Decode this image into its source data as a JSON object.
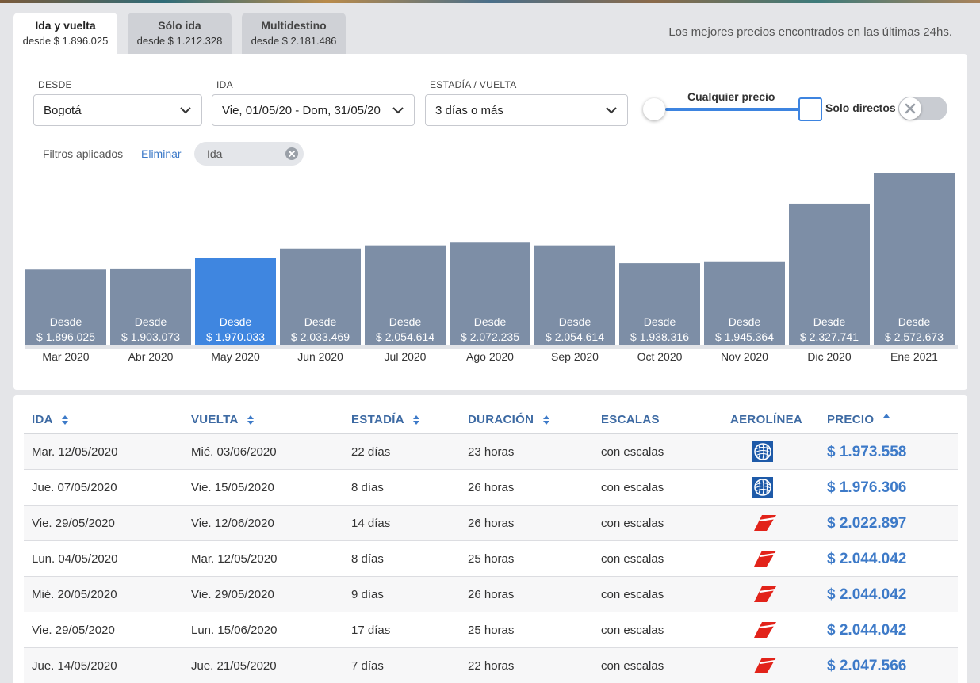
{
  "tabs": [
    {
      "title": "Ida y vuelta",
      "price": "desde $ 1.896.025",
      "active": true
    },
    {
      "title": "Sólo ida",
      "price": "desde $ 1.212.328",
      "active": false
    },
    {
      "title": "Multidestino",
      "price": "desde $ 2.181.486",
      "active": false
    }
  ],
  "best_prices_text": "Los mejores precios encontrados en las últimas 24hs.",
  "search": {
    "desde_label": "DESDE",
    "desde_value": "Bogotá",
    "ida_label": "IDA",
    "ida_value": "Vie, 01/05/20 - Dom, 31/05/20",
    "estadia_label": "ESTADÍA / VUELTA",
    "estadia_value": "3 días o más",
    "price_label": "Cualquier precio",
    "directos_label": "Solo directos",
    "directos_enabled": false
  },
  "filters": {
    "label": "Filtros aplicados",
    "clear": "Eliminar",
    "chips": [
      "Ida"
    ]
  },
  "colors": {
    "bar": "#7d8ea6",
    "bar_selected": "#3f86e0",
    "accent": "#3d7ac8",
    "header": "#3d6aa3"
  },
  "chart_data": {
    "type": "bar",
    "categories": [
      "Mar 2020",
      "Abr 2020",
      "May 2020",
      "Jun 2020",
      "Jul 2020",
      "Ago 2020",
      "Sep 2020",
      "Oct 2020",
      "Nov 2020",
      "Dic 2020",
      "Ene 2021"
    ],
    "values": [
      1896025,
      1903073,
      1970033,
      2033469,
      2054614,
      2072235,
      2054614,
      1938316,
      1945364,
      2327741,
      2572673
    ],
    "bar_prefix": "Desde",
    "value_labels": [
      "$ 1.896.025",
      "$ 1.903.073",
      "$ 1.970.033",
      "$ 2.033.469",
      "$ 2.054.614",
      "$ 2.072.235",
      "$ 2.054.614",
      "$ 1.938.316",
      "$ 1.945.364",
      "$ 2.327.741",
      "$ 2.572.673"
    ],
    "selected_index": 2,
    "ylim": [
      1500000,
      2600000
    ]
  },
  "table": {
    "headers": {
      "ida": "IDA",
      "vuelta": "VUELTA",
      "estadia": "ESTADÍA",
      "duracion": "DURACIÓN",
      "escalas": "ESCALAS",
      "aerolinea": "AEROLÍNEA",
      "precio": "PRECIO"
    },
    "rows": [
      {
        "ida": "Mar. 12/05/2020",
        "vuelta": "Mié. 03/06/2020",
        "estadia": "22 días",
        "duracion": "23 horas",
        "escalas": "con escalas",
        "airline_icon": "united-globe-icon",
        "precio": "$ 1.973.558"
      },
      {
        "ida": "Jue. 07/05/2020",
        "vuelta": "Vie. 15/05/2020",
        "estadia": "8 días",
        "duracion": "26 horas",
        "escalas": "con escalas",
        "airline_icon": "united-globe-icon",
        "precio": "$ 1.976.306"
      },
      {
        "ida": "Vie. 29/05/2020",
        "vuelta": "Vie. 12/06/2020",
        "estadia": "14 días",
        "duracion": "26 horas",
        "escalas": "con escalas",
        "airline_icon": "red-stripe-logo-icon",
        "precio": "$ 2.022.897"
      },
      {
        "ida": "Lun. 04/05/2020",
        "vuelta": "Mar. 12/05/2020",
        "estadia": "8 días",
        "duracion": "25 horas",
        "escalas": "con escalas",
        "airline_icon": "red-stripe-logo-icon",
        "precio": "$ 2.044.042"
      },
      {
        "ida": "Mié. 20/05/2020",
        "vuelta": "Vie. 29/05/2020",
        "estadia": "9 días",
        "duracion": "26 horas",
        "escalas": "con escalas",
        "airline_icon": "red-stripe-logo-icon",
        "precio": "$ 2.044.042"
      },
      {
        "ida": "Vie. 29/05/2020",
        "vuelta": "Lun. 15/06/2020",
        "estadia": "17 días",
        "duracion": "25 horas",
        "escalas": "con escalas",
        "airline_icon": "red-stripe-logo-icon",
        "precio": "$ 2.044.042"
      },
      {
        "ida": "Jue. 14/05/2020",
        "vuelta": "Jue. 21/05/2020",
        "estadia": "7 días",
        "duracion": "22 horas",
        "escalas": "con escalas",
        "airline_icon": "red-stripe-logo-icon",
        "precio": "$ 2.047.566"
      }
    ]
  }
}
